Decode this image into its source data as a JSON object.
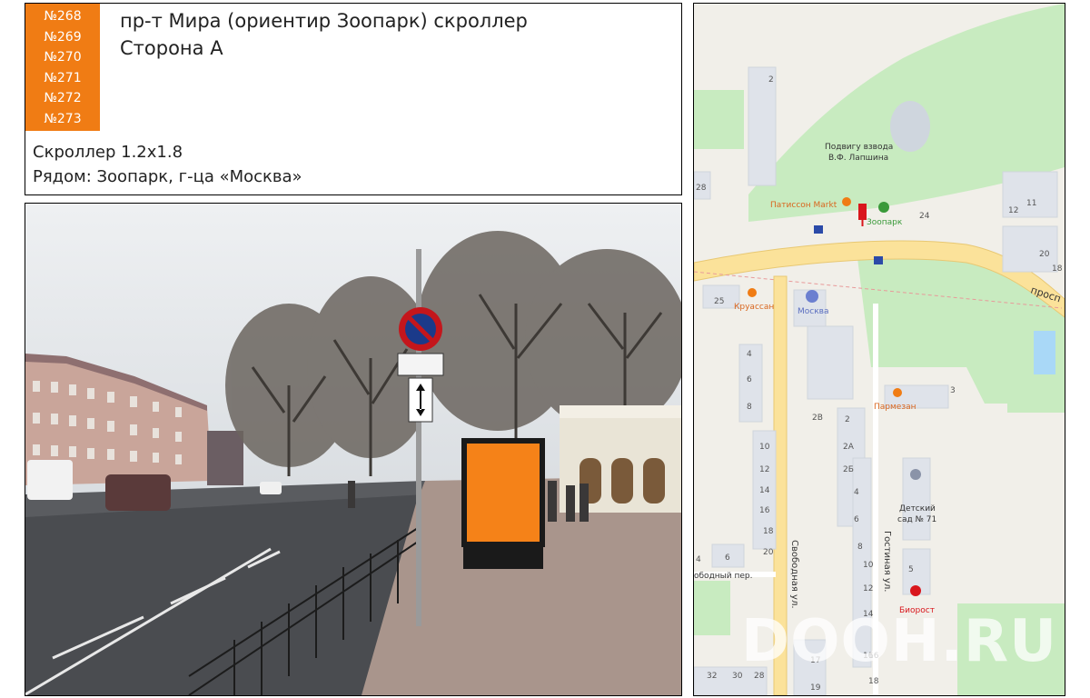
{
  "header": {
    "codes": [
      "№268",
      "№269",
      "№270",
      "№271",
      "№272",
      "№273"
    ],
    "title_line1": "пр-т Мира (ориентир Зоопарк) скроллер",
    "title_line2": "Сторона А",
    "format": "Скроллер 1.2х1.8",
    "nearby": "Рядом: Зоопарк, г-ца «Москва»"
  },
  "map": {
    "labels": {
      "monument": "Подвигу взвода",
      "monument2": "В.Ф. Лапшина",
      "patisson": "Патиссон Markt",
      "zoo": "Зоопарк",
      "croissant": "Круассан",
      "moskva": "Москва",
      "parmezan": "Пармезан",
      "kindergarten": "Детский",
      "kindergarten2": "сад № 71",
      "biorost": "Биорост",
      "svobodnaya": "Свободная ул.",
      "gostinaya": "Гостиная ул.",
      "svobodny_per": "ободный пер.",
      "prosp": "просп"
    },
    "houses": [
      "2",
      "28",
      "24",
      "12",
      "11",
      "20",
      "18",
      "25",
      "4",
      "6",
      "8",
      "3",
      "2В",
      "2",
      "2А",
      "2Б",
      "4",
      "6",
      "8",
      "10",
      "12",
      "14",
      "16",
      "10",
      "12",
      "14",
      "16",
      "18",
      "20",
      "6",
      "4",
      "5",
      "17",
      "19",
      "32",
      "30",
      "28",
      "16",
      "18"
    ],
    "colors": {
      "park": "#c8ebc0",
      "road": "#fbe29a",
      "building": "#dfe3ea",
      "water": "#a9d8f7",
      "marker": "#d9161c"
    }
  },
  "photo": {
    "billboard_color": "#f58218"
  },
  "watermark": "DOOH.RU"
}
